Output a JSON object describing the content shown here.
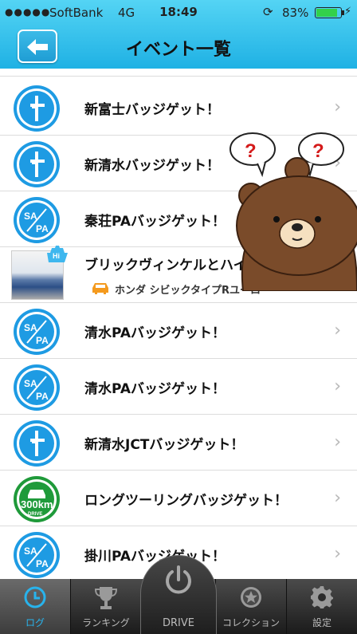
{
  "status": {
    "carrier": "SoftBank",
    "network": "4G",
    "time": "18:49",
    "battery": "83%",
    "signal_dots": "●●●●●"
  },
  "header": {
    "title": "イベント一覧"
  },
  "events": [
    {
      "label": "新富士バッジゲット！",
      "badge": "junction-icon"
    },
    {
      "label": "新清水バッジゲット！",
      "badge": "junction-icon"
    },
    {
      "label": "秦荘PAバッジゲット！",
      "badge": "sapa-icon"
    },
    {
      "label": "ブリックヴィンケルとハイタ",
      "badge": "photo-thumbnail",
      "sub": "ホンダ シビックタイプRユーロ"
    },
    {
      "label": "清水PAバッジゲット！",
      "badge": "sapa-icon"
    },
    {
      "label": "清水PAバッジゲット！",
      "badge": "sapa-icon"
    },
    {
      "label": "新清水JCTバッジゲット！",
      "badge": "junction-icon"
    },
    {
      "label": "ロングツーリングバッジゲット！",
      "badge": "drive-300km-icon",
      "badge_km": "300km",
      "badge_drive": "DRIVE"
    },
    {
      "label": "掛川PAバッジゲット！",
      "badge": "sapa-icon"
    }
  ],
  "sapa_text": {
    "top": "SA",
    "bottom": "PA"
  },
  "thumb_tag": "Hi",
  "tabs": {
    "log": "ログ",
    "ranking": "ランキング",
    "drive": "DRIVE",
    "collection": "コレクション",
    "settings": "設定"
  },
  "colors": {
    "header_top": "#54d4f4",
    "header_bottom": "#1fb1e4",
    "badge_blue": "#1e9be3",
    "badge_green": "#1f9a3a",
    "active_tab": "#28b3ec"
  }
}
